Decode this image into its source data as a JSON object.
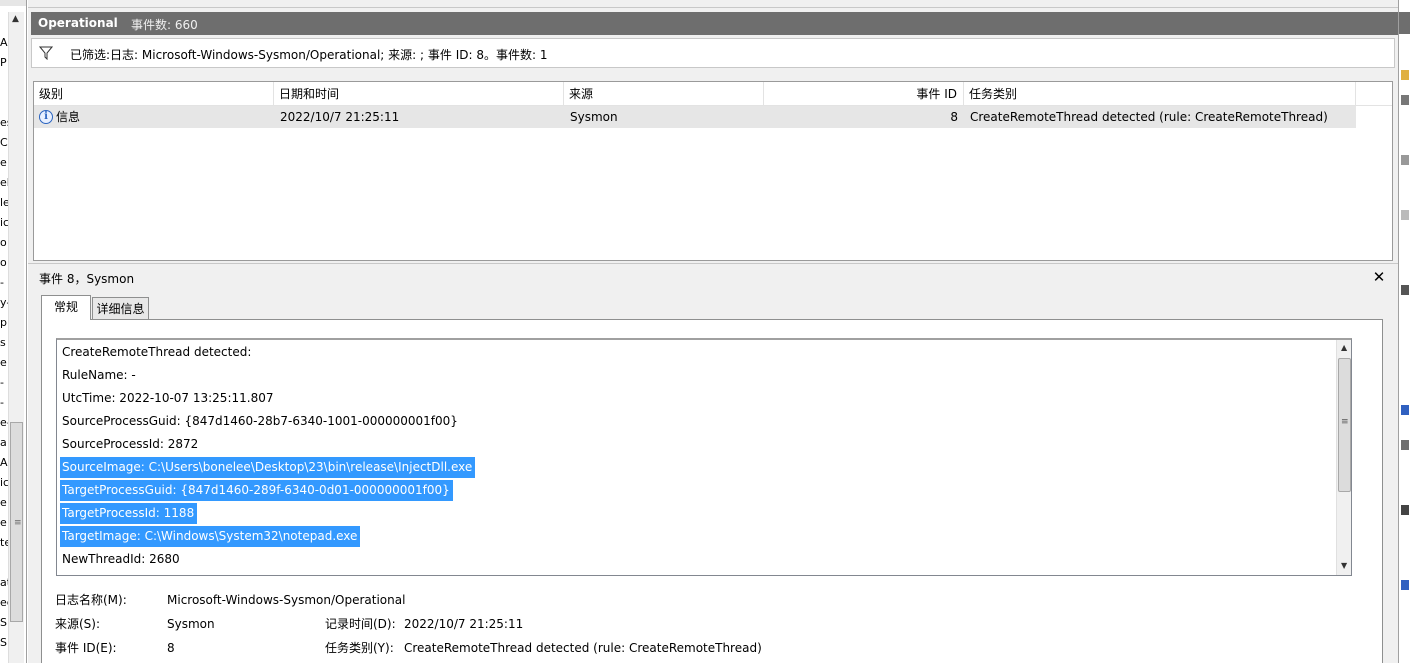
{
  "header": {
    "title": "Operational",
    "count_label": "事件数: 660"
  },
  "filter": {
    "icon": "filter-icon",
    "text": "已筛选:日志: Microsoft-Windows-Sysmon/Operational; 来源: ; 事件 ID: 8。事件数: 1"
  },
  "grid": {
    "columns": [
      "级别",
      "日期和时间",
      "来源",
      "事件 ID",
      "任务类别"
    ],
    "rows": [
      {
        "level_icon": "info-icon",
        "level": "信息",
        "datetime": "2022/10/7 21:25:11",
        "source": "Sysmon",
        "event_id": "8",
        "task": "CreateRemoteThread detected (rule: CreateRemoteThread)"
      }
    ]
  },
  "detail": {
    "title": "事件 8，Sysmon",
    "tabs": [
      "常规",
      "详细信息"
    ],
    "message_lines": [
      "CreateRemoteThread detected:",
      "RuleName: -",
      "UtcTime: 2022-10-07 13:25:11.807",
      "SourceProcessGuid: {847d1460-28b7-6340-1001-000000001f00}",
      "SourceProcessId: 2872",
      "SourceImage: C:\\Users\\bonelee\\Desktop\\23\\bin\\release\\InjectDll.exe",
      "TargetProcessGuid: {847d1460-289f-6340-0d01-000000001f00}",
      "TargetProcessId: 1188",
      "TargetImage: C:\\Windows\\System32\\notepad.exe",
      "NewThreadId: 2680"
    ],
    "properties": {
      "log_name_label": "日志名称(M):",
      "log_name_value": "Microsoft-Windows-Sysmon/Operational",
      "source_label": "来源(S):",
      "source_value": "Sysmon",
      "logged_label": "记录时间(D):",
      "logged_value": "2022/10/7 21:25:11",
      "event_id_label": "事件 ID(E):",
      "event_id_value": "8",
      "task_label": "任务类别(Y):",
      "task_value": "CreateRemoteThread detected (rule: CreateRemoteThread)"
    }
  },
  "left_pane": {
    "fragments": [
      "A",
      "P",
      "es",
      "C",
      "e",
      "el",
      "le",
      "ic",
      "o",
      "o",
      "-",
      "y-",
      "p",
      "s",
      "e",
      "-",
      "-",
      "e-",
      "a",
      "A",
      "ic",
      "e",
      "e",
      "te",
      "at",
      "ec",
      "S",
      "S"
    ]
  },
  "colors": {
    "header_bg": "#6e6e6e",
    "selection": "#3399ff",
    "row_selected": "#e6e6e6"
  }
}
